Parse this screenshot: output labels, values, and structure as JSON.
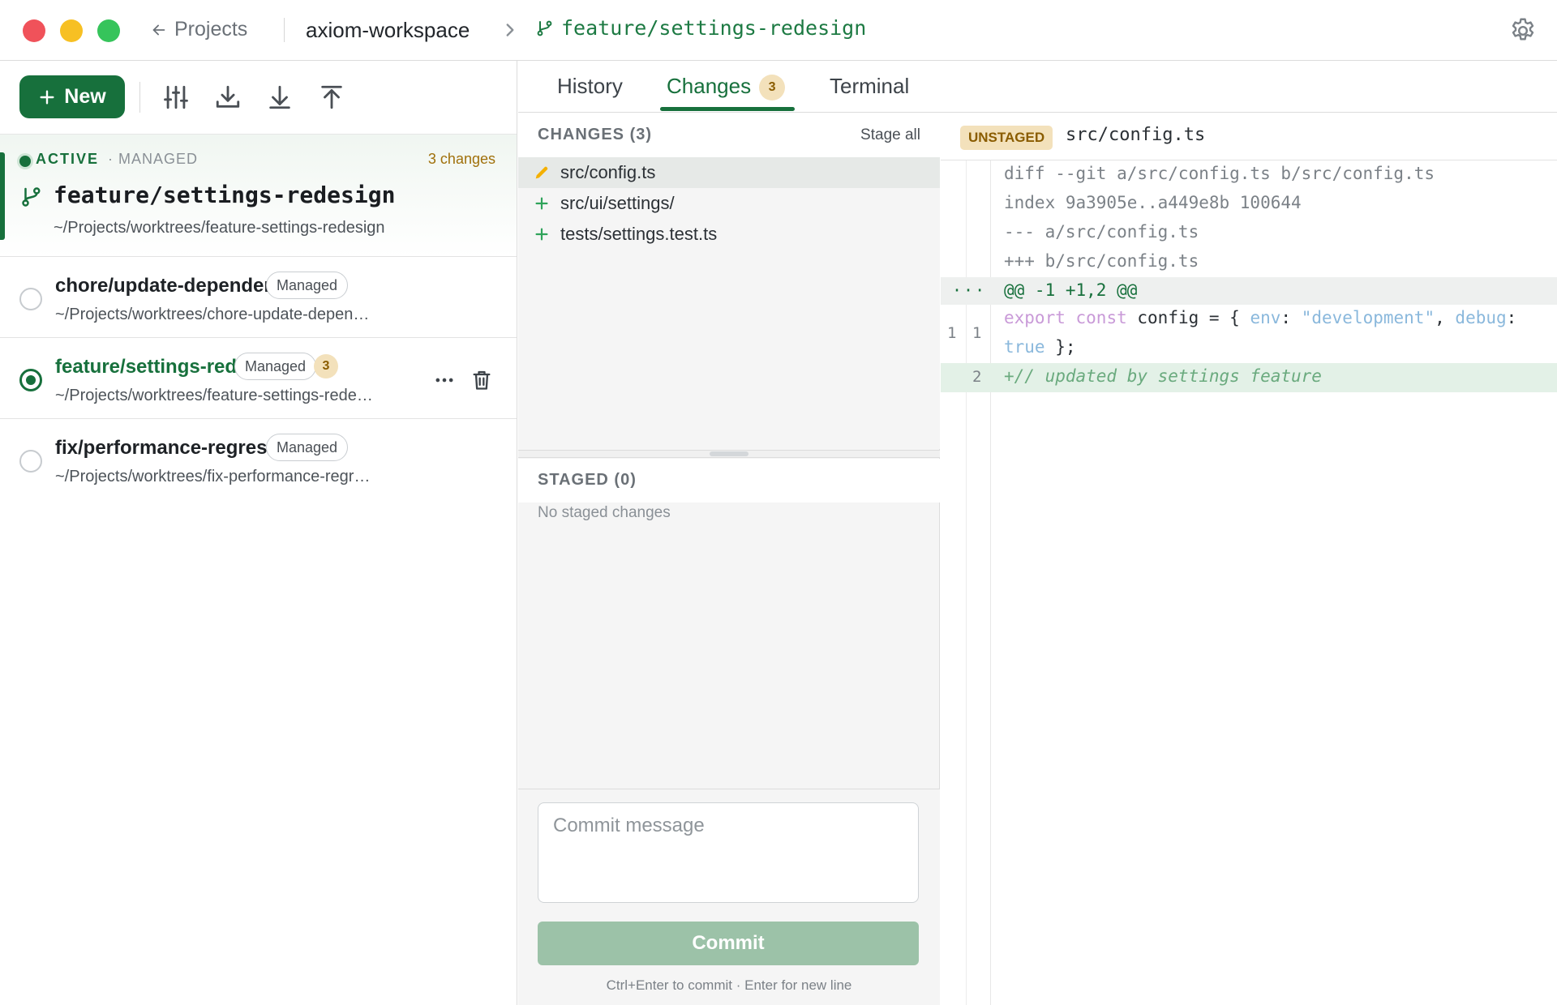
{
  "titlebar": {
    "back_label": "Projects",
    "workspace": "axiom-workspace",
    "branch": "feature/settings-redesign"
  },
  "toolbar": {
    "new_label": "New"
  },
  "active_worktree": {
    "status": "ACTIVE",
    "managed": "· MANAGED",
    "changes": "3 changes",
    "branch": "feature/settings-redesign",
    "path": "~/Projects/worktrees/feature-settings-redesign"
  },
  "worktrees": [
    {
      "name": "chore/update-dependen…",
      "path": "~/Projects/worktrees/chore-update-depen…",
      "badge": "Managed",
      "selected": false
    },
    {
      "name": "feature/settings-red…",
      "path": "~/Projects/worktrees/feature-settings-rede…",
      "badge": "Managed",
      "count": "3",
      "selected": true
    },
    {
      "name": "fix/performance-regressi…",
      "path": "~/Projects/worktrees/fix-performance-regr…",
      "badge": "Managed",
      "selected": false
    }
  ],
  "tabs": {
    "history": "History",
    "changes": "Changes",
    "changes_count": "3",
    "terminal": "Terminal"
  },
  "changes_panel": {
    "title": "CHANGES (3)",
    "stage_all": "Stage all",
    "files": [
      {
        "name": "src/config.ts",
        "kind": "modified"
      },
      {
        "name": "src/ui/settings/",
        "kind": "added"
      },
      {
        "name": "tests/settings.test.ts",
        "kind": "added"
      }
    ],
    "staged_title": "STAGED (0)",
    "no_staged": "No staged changes"
  },
  "commit": {
    "placeholder": "Commit message",
    "button": "Commit",
    "hint": "Ctrl+Enter to commit · Enter for new line"
  },
  "diff": {
    "badge": "UNSTAGED",
    "file": "src/config.ts",
    "header_lines": [
      "diff --git a/src/config.ts b/src/config.ts",
      "index 9a3905e..a449e8b 100644",
      "--- a/src/config.ts",
      "+++ b/src/config.ts"
    ],
    "hunk_dots": "···",
    "hunk": "@@ -1 +1,2 @@",
    "line1_old": "1",
    "line1_new": "1",
    "code_kw1": "export",
    "code_kw2": "const",
    "code_ident": "config = {",
    "code_prop1": "env",
    "code_colon1": ":",
    "code_str": "\"development\"",
    "code_comma": ",",
    "code_prop2": "debug",
    "code_colon2": ":",
    "code_bool": "true",
    "code_end": "};",
    "line2_new": "2",
    "added_line": "+// updated by settings feature"
  },
  "colors": {
    "accent": "#17703c",
    "warning": "#a0700b",
    "badge_bg": "#f3e1bb"
  }
}
